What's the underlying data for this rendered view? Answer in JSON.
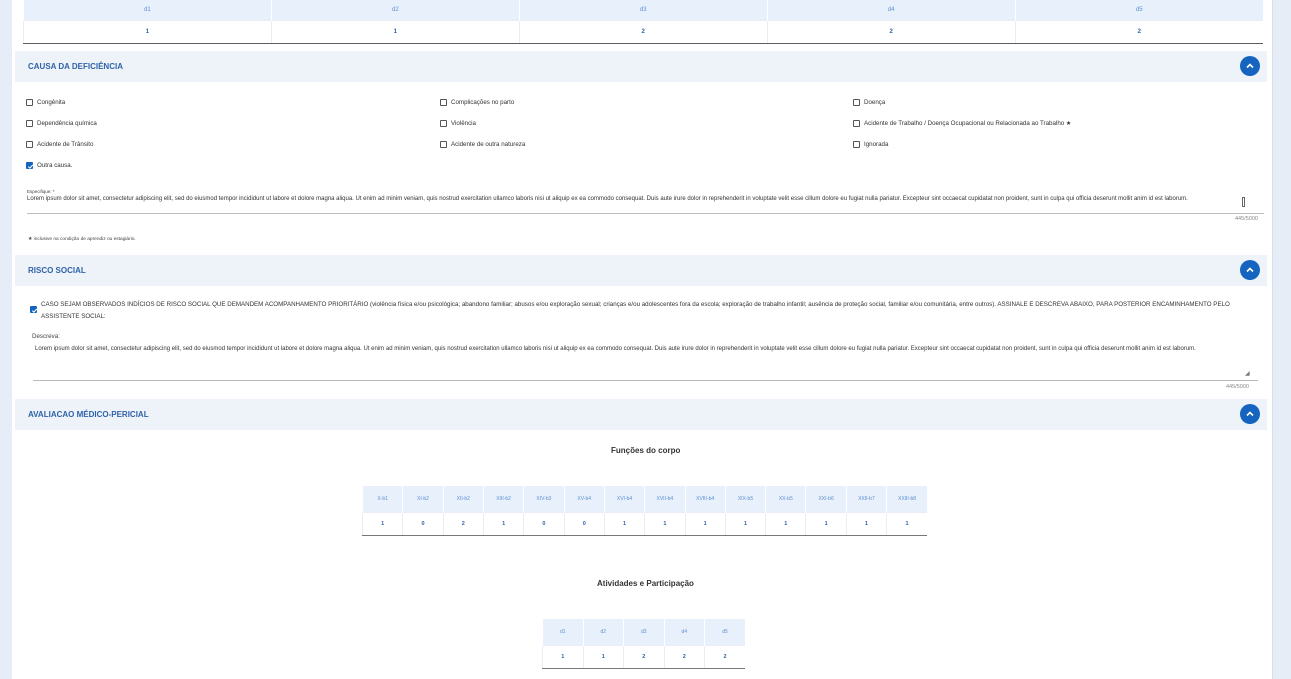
{
  "top_table": {
    "headers": [
      "d1",
      "d2",
      "d3",
      "d4",
      "d5"
    ],
    "values": [
      "1",
      "1",
      "2",
      "2",
      "2"
    ]
  },
  "causa": {
    "title": "CAUSA DA DEFICIÊNCIA",
    "options": [
      {
        "label": "Congênita",
        "checked": false
      },
      {
        "label": "Complicações no parto",
        "checked": false
      },
      {
        "label": "Doença",
        "checked": false
      },
      {
        "label": "Dependência química",
        "checked": false
      },
      {
        "label": "Violência",
        "checked": false
      },
      {
        "label": "Acidente de Trabalho / Doença Ocupacional ou Relacionada ao Trabalho ★",
        "checked": false
      },
      {
        "label": "Acidente de Trânsito",
        "checked": false
      },
      {
        "label": "Acidente de outra natureza",
        "checked": false
      },
      {
        "label": "Ignorada",
        "checked": false
      },
      {
        "label": "Outra causa.",
        "checked": true
      }
    ],
    "especifique_label": "Especifique: *",
    "especifique_text": "Lorem ipsum dolor sit amet, consectetur adipiscing elit, sed do eiusmod tempor incididunt ut labore et dolore magna aliqua. Ut enim ad minim veniam, quis nostrud exercitation ullamco laboris nisi ut aliquip ex ea commodo consequat. Duis aute irure dolor in reprehenderit in voluptate velit esse cillum dolore eu fugiat nulla pariatur. Excepteur sint occaecat cupidatat non proident, sunt in culpa qui officia deserunt mollit anim id est laborum.",
    "counter": "445/5000",
    "footnote": "★ inclusive na condição de aprendiz ou estagiário."
  },
  "risco": {
    "title": "RISCO SOCIAL",
    "checkbox_text": "CASO SEJAM OBSERVADOS INDÍCIOS DE RISCO SOCIAL QUE DEMANDEM ACOMPANHAMENTO PRIORITÁRIO (violência física e/ou psicológica; abandono familiar; abusos e/ou exploração sexual; crianças e/ou adolescentes fora da escola; exploração de trabalho infantil; ausência de proteção social, familiar e/ou comunitária, entre outros). ASSINALE E DESCREVA ABAIXO, PARA POSTERIOR ENCAMINHAMENTO PELO ASSISTENTE SOCIAL:",
    "checked": true,
    "descreva_label": "Descreva:",
    "descreva_text": "Lorem ipsum dolor sit amet, consectetur adipiscing elit, sed do eiusmod tempor incididunt ut labore et dolore magna aliqua. Ut enim ad minim veniam, quis nostrud exercitation ullamco laboris nisi ut aliquip ex ea commodo consequat. Duis aute irure dolor in reprehenderit in voluptate velit esse cillum dolore eu fugiat nulla pariatur. Excepteur sint occaecat cupidatat non proident, sunt in culpa qui officia deserunt mollit anim id est laborum.",
    "counter": "445/5000"
  },
  "avaliacao": {
    "title": "AVALIACAO MÉDICO-PERICIAL",
    "funcoes_title": "Funções do corpo",
    "funcoes_headers": [
      "X-b1",
      "XI-b2",
      "XII-b2",
      "XIII-b2",
      "XIV-b3",
      "XV-b4",
      "XVI-b4",
      "XVII-b4",
      "XVIII-b4",
      "XIX-b5",
      "XX-b5",
      "XXI-b6",
      "XXII-b7",
      "XXIII-b8"
    ],
    "funcoes_values": [
      "1",
      "0",
      "2",
      "1",
      "0",
      "0",
      "1",
      "1",
      "1",
      "1",
      "1",
      "1",
      "1",
      "1"
    ],
    "atividades_title": "Atividades e Participação",
    "atividades_headers": [
      "d1",
      "d2",
      "d3",
      "d4",
      "d5"
    ],
    "atividades_values": [
      "1",
      "1",
      "2",
      "2",
      "2"
    ]
  },
  "colors": {
    "accent": "#1565c0",
    "header_bg": "#eef3fa",
    "table_header_bg": "#e8f0fb",
    "link_blue": "#2f62a8"
  },
  "icons": {
    "toggle": "chevron-up-icon",
    "check": "check-icon"
  }
}
